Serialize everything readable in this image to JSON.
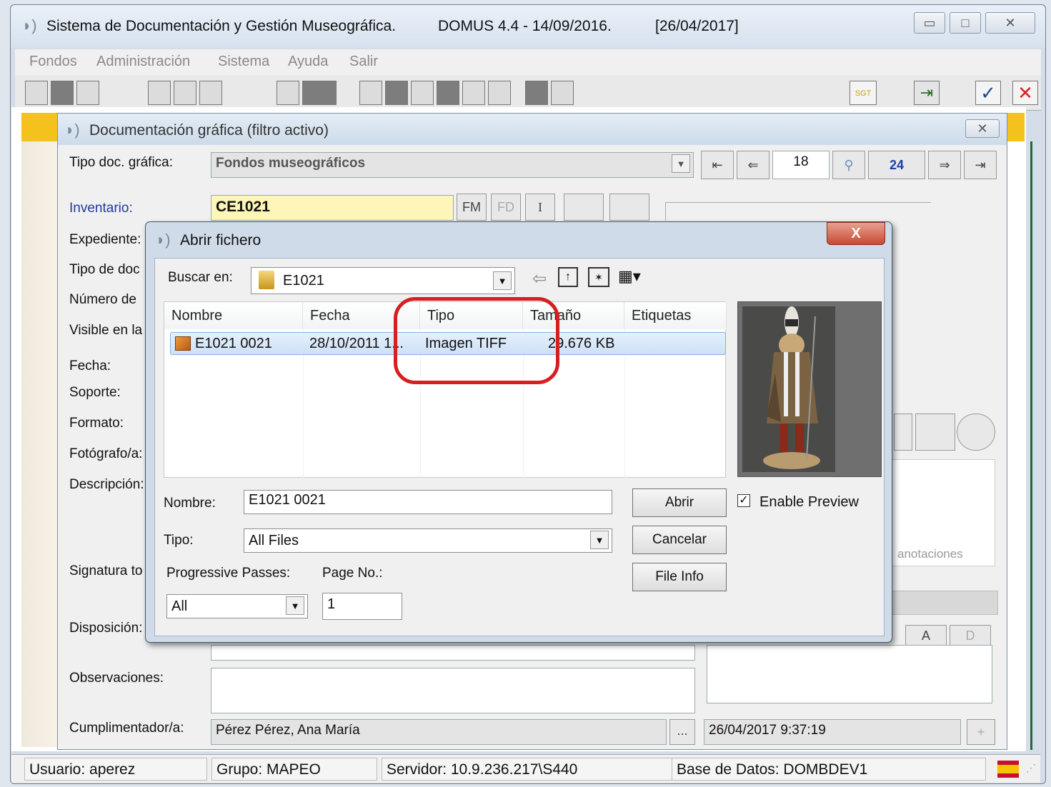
{
  "app": {
    "title": "Sistema de Documentación y Gestión Museográfica.",
    "version": "DOMUS 4.4 - 14/09/2016.",
    "date": "[26/04/2017]"
  },
  "menu": [
    "Fondos",
    "Administración",
    "Sistema",
    "Ayuda",
    "Salir"
  ],
  "toolbar": {
    "sgt_label": "SGT"
  },
  "inner": {
    "title": "Documentación gráfica (filtro activo)",
    "tipo_label": "Tipo doc. gráfica:",
    "tipo_value": "Fondos museográficos",
    "record_current": "18",
    "record_total": "24",
    "inventario_label": "Inventario:",
    "inventario_value": "CE1021",
    "btn_fm": "FM",
    "btn_fd": "FD",
    "btn_i": "I",
    "labels": {
      "expediente": "Expediente:",
      "tipo_doc": "Tipo de doc",
      "numero": "Número de",
      "visible": "Visible en la",
      "fecha": "Fecha:",
      "soporte": "Soporte:",
      "formato": "Formato:",
      "fotografo": "Fotógrafo/a:",
      "descripcion": "Descripción:",
      "signatura": "Signatura to",
      "disposicion": "Disposición:",
      "observaciones": "Observaciones:",
      "cumplimentador": "Cumplimentador/a:"
    },
    "anotaciones": "anotaciones",
    "btn_a": "A",
    "btn_d": "D",
    "cumplimentador_value": "Pérez Pérez, Ana María",
    "ellipsis": "...",
    "timestamp": "26/04/2017 9:37:19",
    "plus": "+"
  },
  "dialog": {
    "title": "Abrir fichero",
    "close": "X",
    "buscar_label": "Buscar en:",
    "folder": "E1021",
    "columns": [
      "Nombre",
      "Fecha",
      "Tipo",
      "Tamaño",
      "Etiquetas"
    ],
    "file": {
      "name": "E1021 0021",
      "date": "28/10/2011 1...",
      "type": "Imagen TIFF",
      "size": "29.676 KB"
    },
    "nombre_label": "Nombre:",
    "nombre_value": "E1021 0021",
    "tipo_label": "Tipo:",
    "tipo_value": "All Files",
    "abrir": "Abrir",
    "cancelar": "Cancelar",
    "file_info": "File Info",
    "enable_preview": "Enable Preview",
    "progressive_label": "Progressive Passes:",
    "progressive_value": "All",
    "page_label": "Page No.:",
    "page_value": "1"
  },
  "status": {
    "usuario": "Usuario: aperez",
    "grupo": "Grupo: MAPEO",
    "servidor": "Servidor: 10.9.236.217\\S440",
    "base": "Base de Datos: DOMBDEV1"
  },
  "colors": {
    "highlight_circle": "#d42020",
    "yellow_strip": "#f4c21c",
    "inventario_yellow": "#fdf6b8",
    "record_total_blue": "#1a3fa8"
  }
}
